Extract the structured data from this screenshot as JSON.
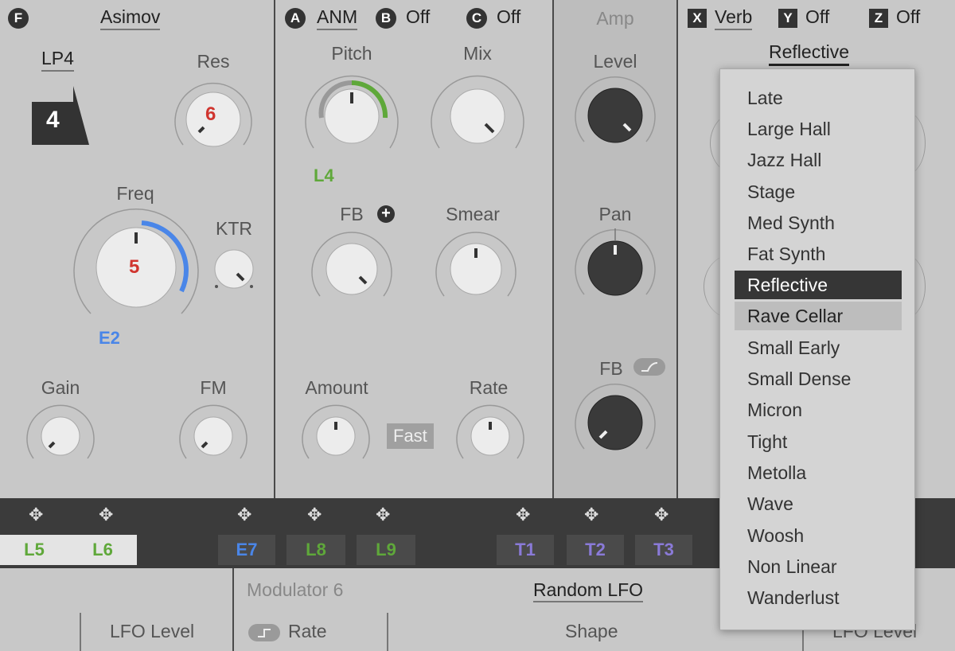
{
  "filter": {
    "slot_badge": "F",
    "name": "Asimov",
    "type_label": "LP4",
    "type_badge": "4",
    "res_label": "Res",
    "res_value": "6",
    "freq_label": "Freq",
    "freq_value": "5",
    "freq_mod": "E2",
    "ktr_label": "KTR",
    "gain_label": "Gain",
    "fm_label": "FM"
  },
  "modifiers": {
    "a_badge": "A",
    "a_value": "ANM",
    "b_badge": "B",
    "b_value": "Off",
    "c_badge": "C",
    "c_value": "Off",
    "pitch_label": "Pitch",
    "pitch_mod": "L4",
    "mix_label": "Mix",
    "fb_label": "FB",
    "fb_plus": "+",
    "smear_label": "Smear",
    "amount_label": "Amount",
    "rate_label": "Rate",
    "fast_label": "Fast"
  },
  "amp": {
    "title": "Amp",
    "level_label": "Level",
    "pan_label": "Pan",
    "fb_label": "FB"
  },
  "fx": {
    "x_badge": "X",
    "x_value": "Verb",
    "y_badge": "Y",
    "y_value": "Off",
    "z_badge": "Z",
    "z_value": "Off",
    "preset": "Reflective"
  },
  "mod_bar": {
    "tags": [
      "L5",
      "L6",
      "E7",
      "L8",
      "L9",
      "T1",
      "T2",
      "T3"
    ],
    "move_icon": "✥"
  },
  "bottom": {
    "lfo_level_left": "LFO Level",
    "modulator_title": "Modulator 6",
    "modulator_type": "Random LFO",
    "rate_label": "Rate",
    "shape_label": "Shape",
    "lfo_level_right": "LFO Level"
  },
  "preset_menu": {
    "items": [
      "Late",
      "Large Hall",
      "Jazz Hall",
      "Stage",
      "Med Synth",
      "Fat Synth",
      "Reflective",
      "Rave Cellar",
      "Small Early",
      "Small Dense",
      "Micron",
      "Tight",
      "Metolla",
      "Wave",
      "Woosh",
      "Non Linear",
      "Wanderlust"
    ],
    "selected": "Reflective",
    "hovered": "Rave Cellar"
  },
  "colors": {
    "green": "#5fa83a",
    "blue": "#4a86e8",
    "red": "#d0352f",
    "purple": "#8a7ad8"
  }
}
